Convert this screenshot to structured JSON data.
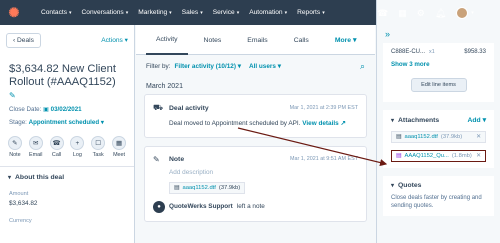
{
  "nav": {
    "menu": [
      "Contacts",
      "Conversations",
      "Marketing",
      "Sales",
      "Service",
      "Automation",
      "Reports"
    ]
  },
  "left": {
    "back_label": "‹ Deals",
    "actions_label": "Actions",
    "deal_title": "$3,634.82 New Client Rollout (#AAAQ1152)",
    "close_date_label": "Close Date:",
    "close_date_value": "03/02/2021",
    "stage_label": "Stage:",
    "stage_value": "Appointment scheduled",
    "quick_actions": [
      "Note",
      "Email",
      "Call",
      "Log",
      "Task",
      "Meet"
    ],
    "about_label": "About this deal",
    "amount_label": "Amount",
    "amount_value": "$3,634.82",
    "currency_label": "Currency"
  },
  "middle": {
    "tabs": [
      "Activity",
      "Notes",
      "Emails",
      "Calls"
    ],
    "more_label": "More",
    "filter_label": "Filter by:",
    "filter_activity": "Filter activity (10/12)",
    "filter_users": "All users",
    "month": "March 2021",
    "deal_activity": {
      "title": "Deal activity",
      "time": "Mar 1, 2021 at 2:39 PM EST",
      "text": "Deal moved to Appointment scheduled by API.",
      "link": "View details"
    },
    "note": {
      "title": "Note",
      "time": "Mar 1, 2021 at 9:51 AM EST",
      "placeholder": "Add description",
      "attachment_name": "aaaq1152.dtf",
      "attachment_size": "(37.9kb)",
      "author": "QuoteWerks Support",
      "author_suffix": "left a note"
    }
  },
  "right": {
    "product_code": "C888E-CU...",
    "product_qty": "x1",
    "product_price": "$958.33",
    "show_more": "Show 3 more",
    "edit_line_items": "Edit line items",
    "attachments_label": "Attachments",
    "add_label": "Add",
    "files": [
      {
        "name": "aaaq1152.dtf",
        "size": "(37.9kb)"
      },
      {
        "name": "AAAQ1152_Qu...",
        "size": "(1.8mb)"
      }
    ],
    "quotes_label": "Quotes",
    "quotes_text": "Close deals faster by creating and sending quotes."
  },
  "colors": {
    "nav_bg": "#2d3e50",
    "link": "#0091ae",
    "highlight": "#6b1a12"
  }
}
